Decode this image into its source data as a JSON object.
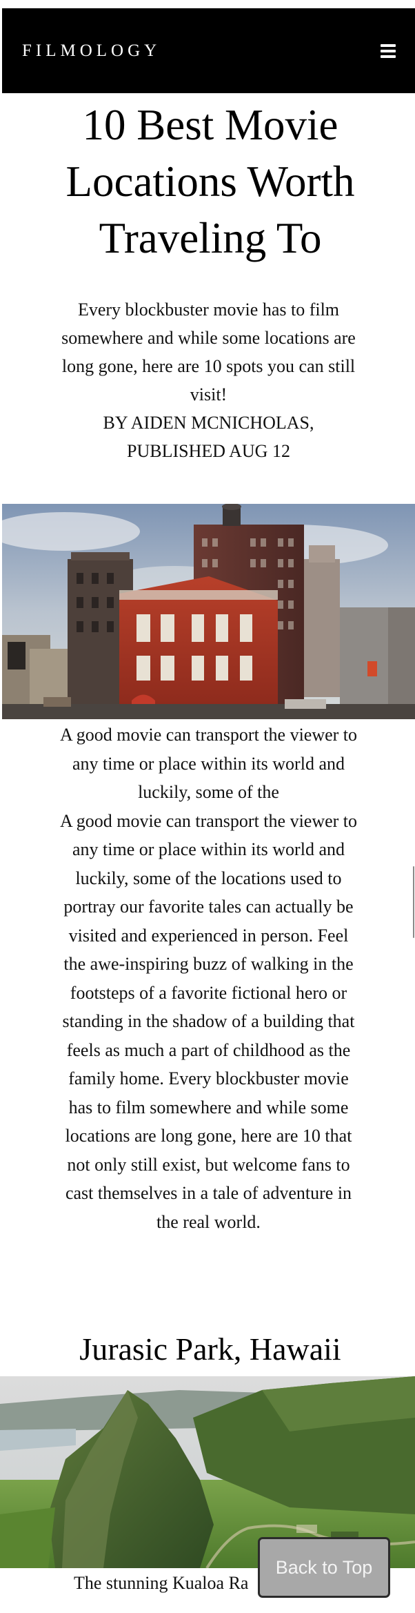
{
  "header": {
    "brand": "FILMOLOGY",
    "menu_icon": "hamburger-menu-icon",
    "background": "#000000",
    "text_color": "#ffffff"
  },
  "article": {
    "title": "10 Best Movie Locations Worth Traveling To",
    "subtitle": "Every blockbuster movie has to film somewhere and while some locations are long gone, here are 10 spots you can still visit!",
    "byline": "BY AIDEN MCNICHOLAS, PUBLISHED AUG 12",
    "body_intro_truncated": "A good movie can transport the viewer to any time or place within its world and luckily, some of the",
    "body": "A good movie can transport the viewer to any time or place within its world and luckily, some of the locations used to portray our favorite tales can actually be visited and experienced in person. Feel the awe-inspiring buzz of walking in the footsteps of a favorite fictional hero or standing in the shadow of a building that feels as much a part of childhood as the family home. Every blockbuster movie has to film somewhere and while some locations are long gone, here are 10 that not only still exist, but welcome fans to cast themselves in a tale of adventure in the real world.",
    "sections": [
      {
        "heading": "Jurasic Park, Hawaii",
        "caption": "The stunning Kualoa Ra"
      }
    ]
  },
  "back_to_top": {
    "label": "Back to Top",
    "background": "#a8a8a8"
  }
}
